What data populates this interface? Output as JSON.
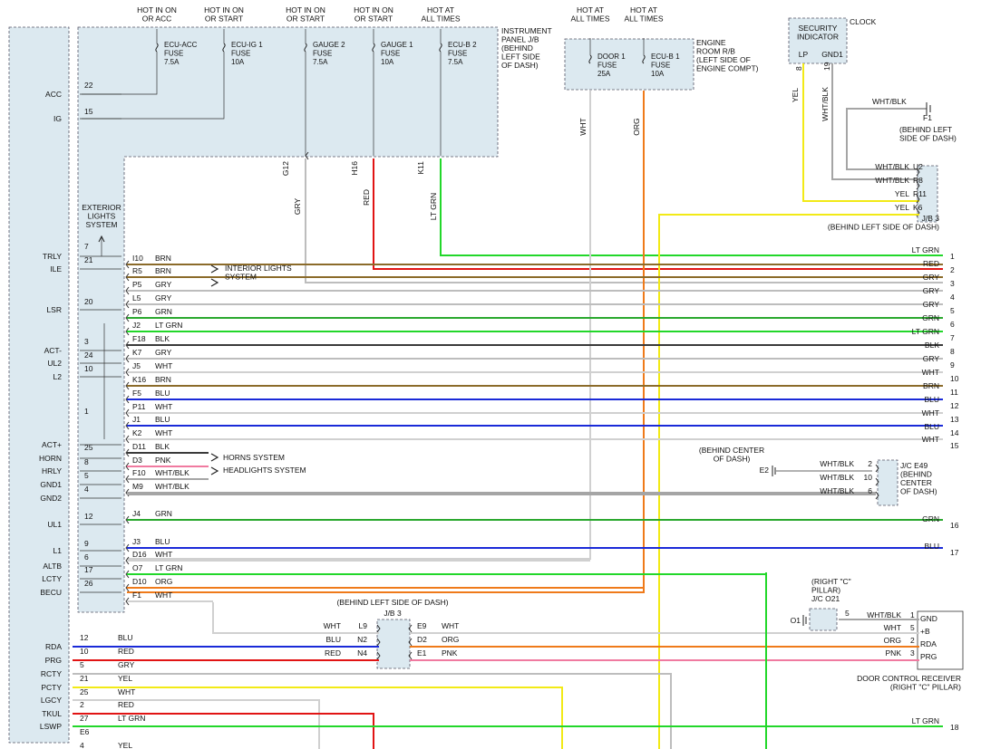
{
  "power_labels": [
    "HOT IN ON\nOR ACC",
    "HOT IN ON\nOR START",
    "HOT IN ON\nOR START",
    "HOT IN ON\nOR START",
    "HOT AT\nALL TIMES",
    "HOT AT\nALL TIMES",
    "HOT AT\nALL TIMES"
  ],
  "fuses": [
    {
      "label": "ECU-ACC\nFUSE\n7.5A"
    },
    {
      "label": "ECU-IG 1\nFUSE\n10A"
    },
    {
      "label": "GAUGE 2\nFUSE\n7.5A"
    },
    {
      "label": "GAUGE 1\nFUSE\n10A"
    },
    {
      "label": "ECU-B 2\nFUSE\n7.5A"
    },
    {
      "label": "DOOR 1\nFUSE\n25A"
    },
    {
      "label": "ECU-B 1\nFUSE\n10A"
    }
  ],
  "instrument_panel_jb": "INSTRUMENT\nPANEL J/B\n(BEHIND\nLEFT SIDE\nOF DASH)",
  "engine_room_rb": "ENGINE\nROOM R/B\n(LEFT SIDE OF\nENGINE COMPT)",
  "jb_connectors": {
    "g12": "G12",
    "h16": "H16",
    "k11": "K11"
  },
  "vertical_wires": {
    "gry": "GRY",
    "red": "RED",
    "ltgrn": "LT GRN",
    "wht": "WHT",
    "org": "ORG",
    "yel": "YEL",
    "whtblk": "WHT/BLK"
  },
  "security": {
    "title": "SECURITY\nINDICATOR",
    "clock": "CLOCK",
    "lp": "LP",
    "gnd1": "GND1",
    "pin_lp": "8",
    "pin_gnd1": "19"
  },
  "ground_f1": {
    "wire": "WHT/BLK",
    "name": "F1",
    "location": "(BEHIND LEFT\nSIDE OF DASH)"
  },
  "jb3_right": {
    "pins": [
      {
        "color": "WHT/BLK",
        "pin": "U2"
      },
      {
        "color": "WHT/BLK",
        "pin": "R8"
      },
      {
        "color": "YEL",
        "pin": "R11"
      },
      {
        "color": "YEL",
        "pin": "K6"
      }
    ],
    "title": "J/B 3\n(BEHIND LEFT SIDE OF DASH)"
  },
  "exterior_lights": "EXTERIOR\nLIGHTS\nSYSTEM",
  "left_terminals": [
    "ACC",
    "IG",
    "TRLY",
    "ILE",
    "LSR",
    "ACT-",
    "UL2",
    "L2",
    "ACT+",
    "HORN",
    "HRLY",
    "GND1",
    "GND2",
    "UL1",
    "L1",
    "ALTB",
    "LCTY",
    "BECU"
  ],
  "lower_terminals": [
    "RDA",
    "PRG",
    "RCTY",
    "PCTY",
    "LGCY",
    "TKUL",
    "LSWP"
  ],
  "lower_nums": [
    "12",
    "10",
    "5",
    "21",
    "25",
    "2",
    "27",
    "E6",
    "4"
  ],
  "lower_colors": [
    "BLU",
    "RED",
    "GRY",
    "YEL",
    "WHT",
    "RED",
    "LT GRN",
    "YEL"
  ],
  "terminal_nums": [
    "22",
    "15",
    "7",
    "21",
    "20",
    "3",
    "24",
    "10",
    "1",
    "25",
    "8",
    "5",
    "4",
    "12",
    "9",
    "6",
    "17",
    "26"
  ],
  "rows": [
    {
      "conn": "I10",
      "color": "BRN"
    },
    {
      "conn": "R5",
      "color": "BRN"
    },
    {
      "conn": "P5",
      "color": "GRY"
    },
    {
      "conn": "L5",
      "color": "GRY"
    },
    {
      "conn": "P6",
      "color": "GRN"
    },
    {
      "conn": "J2",
      "color": "LT GRN"
    },
    {
      "conn": "F18",
      "color": "BLK"
    },
    {
      "conn": "K7",
      "color": "GRY"
    },
    {
      "conn": "J5",
      "color": "WHT"
    },
    {
      "conn": "K16",
      "color": "BRN"
    },
    {
      "conn": "F5",
      "color": "BLU"
    },
    {
      "conn": "P11",
      "color": "WHT"
    },
    {
      "conn": "J1",
      "color": "BLU"
    },
    {
      "conn": "K2",
      "color": "WHT"
    },
    {
      "conn": "D11",
      "color": "BLK"
    },
    {
      "conn": "D3",
      "color": "PNK"
    },
    {
      "conn": "F10",
      "color": "WHT/BLK"
    },
    {
      "conn": "M9",
      "color": "WHT/BLK"
    },
    {
      "conn": "J4",
      "color": "GRN"
    },
    {
      "conn": "J3",
      "color": "BLU"
    },
    {
      "conn": "D16",
      "color": "WHT"
    },
    {
      "conn": "O7",
      "color": "LT GRN"
    },
    {
      "conn": "D10",
      "color": "ORG"
    },
    {
      "conn": "F1",
      "color": "WHT"
    }
  ],
  "system_refs": {
    "interior": "INTERIOR LIGHTS\nSYSTEM",
    "horns": "HORNS SYSTEM",
    "headlights": "HEADLIGHTS SYSTEM"
  },
  "right_outputs": [
    {
      "color": "LT GRN",
      "num": "1"
    },
    {
      "color": "RED",
      "num": "2"
    },
    {
      "color": "GRY",
      "num": "3"
    },
    {
      "color": "GRY",
      "num": "4"
    },
    {
      "color": "GRY",
      "num": "5"
    },
    {
      "color": "GRN",
      "num": "6"
    },
    {
      "color": "LT GRN",
      "num": "7"
    },
    {
      "color": "BLK",
      "num": "8"
    },
    {
      "color": "GRY",
      "num": "9"
    },
    {
      "color": "WHT",
      "num": "10"
    },
    {
      "color": "BRN",
      "num": "11"
    },
    {
      "color": "BLU",
      "num": "12"
    },
    {
      "color": "WHT",
      "num": "13"
    },
    {
      "color": "BLU",
      "num": "14"
    },
    {
      "color": "WHT",
      "num": "15"
    },
    {
      "color": "GRN",
      "num": "16"
    },
    {
      "color": "BLU",
      "num": "17"
    },
    {
      "color": "LT GRN",
      "num": "18"
    }
  ],
  "jc_e49": {
    "title": "J/C E49\n(BEHIND\nCENTER\nOF DASH)",
    "pins": [
      {
        "color": "WHT/BLK",
        "pin": "2"
      },
      {
        "color": "WHT/BLK",
        "pin": "10"
      },
      {
        "color": "WHT/BLK",
        "pin": "6"
      }
    ],
    "ground": "E2",
    "ground_location": "(BEHIND CENTER\nOF DASH)"
  },
  "jb3_bottom": {
    "title": "(BEHIND LEFT SIDE OF DASH)",
    "name": "J/B 3",
    "left": [
      {
        "color": "WHT",
        "pin": "L9"
      },
      {
        "color": "BLU",
        "pin": "N2"
      },
      {
        "color": "RED",
        "pin": "N4"
      }
    ],
    "right": [
      {
        "color": "WHT",
        "pin": "E9"
      },
      {
        "color": "ORG",
        "pin": "D2"
      },
      {
        "color": "PNK",
        "pin": "E1"
      }
    ]
  },
  "jc_o21": {
    "title": "(RIGHT \"C\"\nPILLAR)\nJ/C O21",
    "ground": "O1",
    "pin": "5"
  },
  "receiver": {
    "title": "DOOR CONTROL RECEIVER\n(RIGHT \"C\" PILLAR)",
    "pins": [
      {
        "color": "WHT/BLK",
        "pin": "1",
        "name": "GND"
      },
      {
        "color": "WHT",
        "pin": "5",
        "name": "+B"
      },
      {
        "color": "ORG",
        "pin": "2",
        "name": "RDA"
      },
      {
        "color": "PNK",
        "pin": "3",
        "name": "PRG"
      }
    ]
  },
  "colors": {
    "gry": "#bdbdbd",
    "wht": "#d0d0d0",
    "red": "#e11414",
    "ltgrn": "#22d72a",
    "grn": "#2aa82e",
    "brn": "#8b6b2a",
    "blu": "#1a2ad8",
    "blk": "#3a3a3a",
    "yel": "#f2ea16",
    "org": "#ef7a1a",
    "pnk": "#f07aa0",
    "whtblk": "#a5a5a5",
    "box": "#dce9f0"
  }
}
